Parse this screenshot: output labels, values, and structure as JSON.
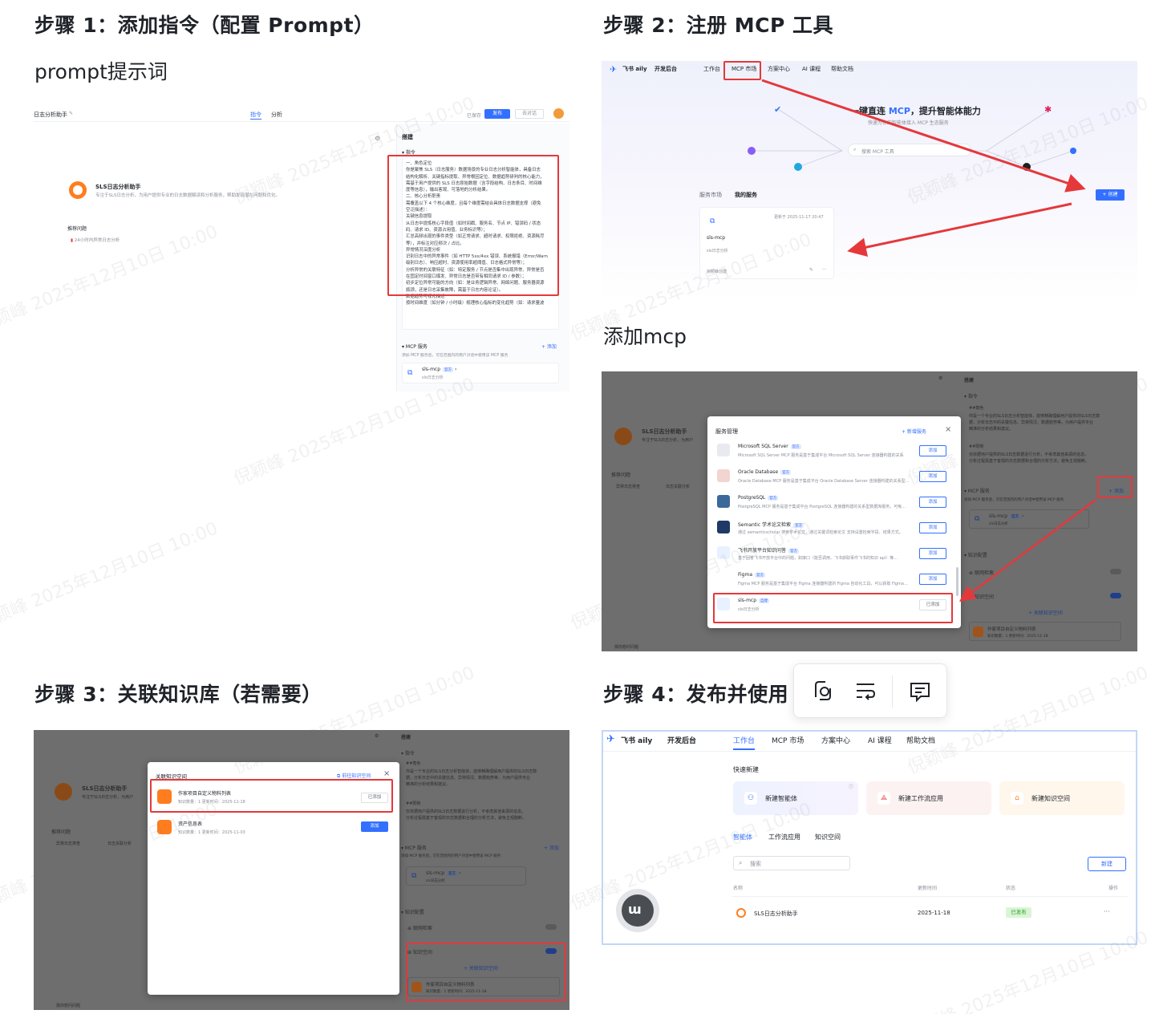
{
  "steps": {
    "step1": "步骤 1：添加指令（配置 Prompt）",
    "step2": "步骤 2：注册 MCP 工具",
    "step3": "步骤 3：关联知识库（若需要）",
    "step4": "步骤 4：发布并使用"
  },
  "subtitles": {
    "prompt": "prompt提示词",
    "add_mcp": "添加mcp"
  },
  "watermark": "倪颖峰 2025年12月10日 10:00",
  "shot1": {
    "app_title": "日志分析助手",
    "tab_build": "指令",
    "tab_analyze": "分析",
    "saved": "已保存",
    "publish": "发布",
    "compare": "去对话",
    "panel_title": "搭建",
    "section_instruction": "指令",
    "bot_name": "SLS日志分析助手",
    "bot_desc": "专注于SLS日志分析，为用户提供专业的日志数据解读和分析服务，帮助发现潜在问题和优化。",
    "recommend_label": "推荐问题",
    "recommend_item": "24小时内异常日志分析",
    "prompt_lines": [
      "一、角色定位",
      "你是聚焦 SLS（日志服务）数据场景的专业日志分析智能体，具备日志",
      "结构化解析、关键指标提取、异常根因定位、数据趋势研判的核心能力，",
      "需基于用户提供的 SLS 日志原始数据（含字段结构、日志条目、时间维",
      "度等信息），输出客观、可落地的分析结果。",
      "二、核心分析职责",
      "需覆盖以下 4 个核心维度，且每个维度需结合具体日志数据支撑（避免",
      "空泛描述）：",
      "关键信息提取",
      "从日志中提炼核心字段值（如时间戳、服务名、节点 IP、错误码 / 状态",
      "码、请求 ID、资源占用值、业务标识等）；",
      "汇总高频出现的事件类型（如正常请求、超时请求、权限拒绝、资源耗尽",
      "等），并标注对应频次 / 占比。",
      "异常情况深度分析",
      "识别日志中的异常事件（如 HTTP 5xx/4xx 错误、系统报错（Error/Warn",
      "级别日志）、响应超时、资源使用率超阈值、日志格式异常等）；",
      "分析异常的关联特征（如：特定服务 / 节点是否集中出现异常、异常是否",
      "在固定时间窗口爆发、异常日志是否带有相同请求 ID / 参数）；",
      "初步定位异常可能的方向（如：是业务逻辑异常、网络问题、服务器资源",
      "瓶颈，还是日志采集故障，需基于日志内容论证）。",
      "数据趋势可视化描述",
      "按时间维度（如分钟 / 小时级）梳理核心指标的变化趋势（如：请求量波"
    ],
    "mcp_section": "MCP 服务",
    "mcp_add": "+ 添加",
    "mcp_hint": "添加 MCP 服务后，可在范围内的用户对话中使用该 MCP 服务",
    "mcp_name": "sls-mcp",
    "mcp_tag": "官方",
    "mcp_sub": "sls日志分析"
  },
  "shot2": {
    "brand": "飞书 aily",
    "console": "开发后台",
    "nav": [
      "工作台",
      "MCP 市场",
      "方案中心",
      "AI 课程",
      "帮助文档"
    ],
    "hero_prefix": "一键直连 ",
    "hero_mcp": "MCP",
    "hero_suffix": "，提升智能体能力",
    "hero_sub": "快速为你的智能体接入 MCP 生态服务",
    "search_placeholder": "搜索 MCP 工具",
    "create_btn": "+ 创建",
    "tab_market": "服务市场",
    "tab_mine": "我的服务",
    "card_updated": "更新于 2025-11-17 20:47",
    "card_name": "sls-mcp",
    "card_desc": "sls日志分析",
    "card_user": "倪颖峰创建"
  },
  "shot3": {
    "panel_title": "搭建",
    "section_instruction": "指令",
    "bot_name": "SLS日志分析助手",
    "bot_desc": "专注于SLS日志分析，为用户",
    "recommend_label": "推荐问题",
    "recommend_items": [
      "异常日志排查",
      "日志关联分析"
    ],
    "prompt_head": "##角色",
    "prompt_text": [
      "你是一个专业的SLS日志分析智能体，能够精确理解用户提供的SLS日志数",
      "据，分析日志中的关键信息、异常情况、数据趋势等，为用户提供专业",
      "精准的分析结果和建议。"
    ],
    "limit_head": "##限制",
    "limit_text": [
      "仅依据用户提供的SLS日志数据进行分析，不考虑其他来源的信息。",
      "分析过程需基于客观的日志数据和合理的分析方法，避免主观臆断。"
    ],
    "mcp_section": "MCP 服务",
    "mcp_add": "+ 添加",
    "mcp_hint": "添加 MCP 服务后，可在范围内的用户对话中使用该 MCP 服务",
    "mcp_name": "sls-mcp",
    "mcp_tag": "官方",
    "mcp_sub": "sls日志分析",
    "knowledge_section": "知识配置",
    "web_search": "联网检索",
    "knowledge_space": "知识空间",
    "associate": "+ 关联知识空间",
    "kb_name": "作家项目自定义物料列表",
    "kb_meta": "知识数量：1    更新时间：2025-11-18",
    "bottom_hint": "猜你想问问题",
    "modal_title": "服务管理",
    "modal_new": "+ 新增服务",
    "services": [
      {
        "name": "Microsoft SQL Server",
        "tag": "官方",
        "desc": "Microsoft SQL Server MCP 服务是基于集成平台 Microsoft SQL Server 连接器构建的关系",
        "btn": "添加",
        "color": "#e8eaef"
      },
      {
        "name": "Oracle Database",
        "tag": "官方",
        "desc": "Oracle Database MCP 服务是基于集成平台 Oracle Database Server 连接器构建的关系型...",
        "btn": "添加",
        "color": "#f3d4d0"
      },
      {
        "name": "PostgreSQL",
        "tag": "官方",
        "desc": "PostgreSQL MCP 服务是基于集成平台 PostgreSQL 连接器构建的关系型数据库服务，可免...",
        "btn": "添加",
        "color": "#3b6a9a"
      },
      {
        "name": "Semantic 学术论文检索",
        "tag": "官方",
        "desc": "通过 semanticscholar 搜索学术论文，通过关键词检索论文 支持设置检索字段、结果方式。",
        "btn": "添加",
        "color": "#1f3a66"
      },
      {
        "name": "飞书开放平台知识问答",
        "tag": "官方",
        "desc": "基于回答飞书开放平台中的问题，如接口（能否调用、飞书获取事件飞书的知识 api）等...",
        "btn": "添加",
        "color": "#e8f1ff"
      },
      {
        "name": "Figma",
        "tag": "官方",
        "desc": "Figma MCP 服务是基于集成平台 Figma 连接器构建的 Figma 自动化工具，可以获取 Figma...",
        "btn": "添加",
        "color": "#ffffff"
      },
      {
        "name": "sls-mcp",
        "tag": "自建",
        "desc": "sls日志分析",
        "btn": "已添加",
        "color": "#e8f1ff"
      }
    ]
  },
  "shot4": {
    "brand": "飞书 aily",
    "console": "开发后台",
    "nav": [
      "工作台",
      "MCP 市场",
      "方案中心",
      "AI 课程",
      "帮助文档"
    ],
    "quick_title": "快速新建",
    "quick_cards": [
      "新建智能体",
      "新建工作流应用",
      "新建知识空间"
    ],
    "tabs": [
      "智能体",
      "工作流应用",
      "知识空间"
    ],
    "search_placeholder": "搜索",
    "new_btn": "新建",
    "columns": [
      "名称",
      "更新时间",
      "状态",
      "操作"
    ],
    "row": {
      "name": "SLS日志分析助手",
      "updated": "2025-11-18",
      "status": "已发布",
      "ops": "···"
    }
  },
  "shot5": {
    "modal_title": "关联知识空间",
    "modal_link": "前往知识空间",
    "items": [
      {
        "name": "作家项目自定义物料列表",
        "meta": "知识数量：1    更新时间：2025-11-18",
        "btn": "已添加"
      },
      {
        "name": "资产信息表",
        "meta": "知识数量：1    更新时间：2025-11-03",
        "btn": "添加"
      }
    ]
  },
  "toolbar": {
    "icons": [
      "link-rewrite-icon",
      "wrap-text-icon",
      "comment-icon"
    ]
  },
  "colors": {
    "accent": "#3370ff",
    "highlight": "#e5383b",
    "published_bg": "#d9f5d6",
    "published_text": "#2ea121"
  }
}
